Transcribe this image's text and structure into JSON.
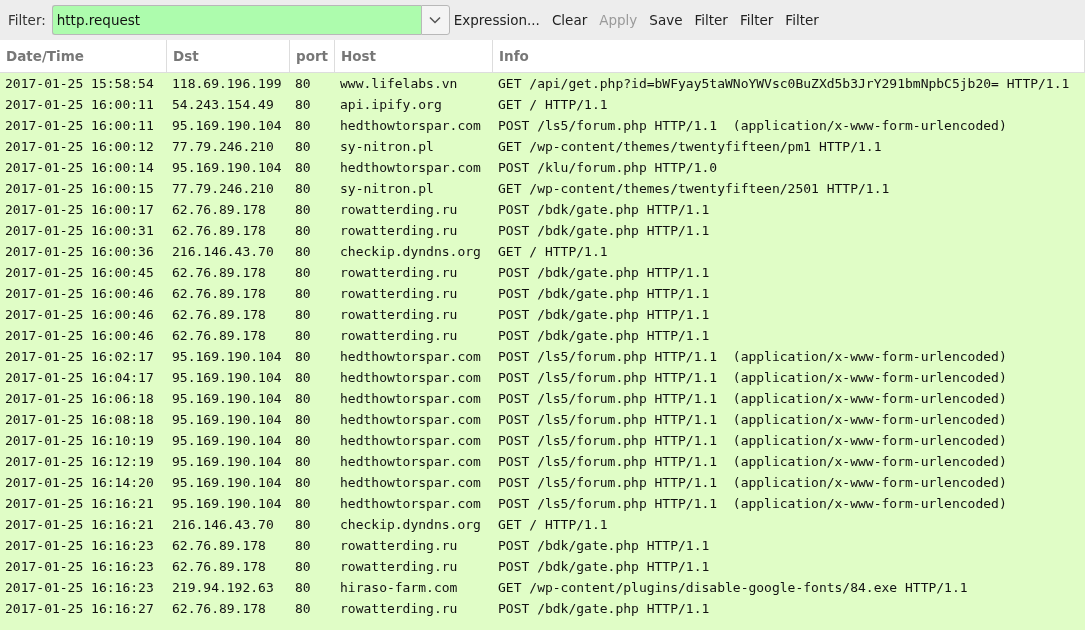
{
  "filter_bar": {
    "label": "Filter:",
    "value": "http.request",
    "buttons": [
      {
        "label": "Expression...",
        "disabled": false
      },
      {
        "label": "Clear",
        "disabled": false
      },
      {
        "label": "Apply",
        "disabled": true
      },
      {
        "label": "Save",
        "disabled": false
      },
      {
        "label": "Filter",
        "disabled": false
      },
      {
        "label": "Filter",
        "disabled": false
      },
      {
        "label": "Filter",
        "disabled": false
      }
    ]
  },
  "table": {
    "columns": [
      "Date/Time",
      "Dst",
      "port",
      "Host",
      "Info"
    ],
    "rows": [
      [
        "2017-01-25 15:58:54",
        "118.69.196.199",
        "80",
        "www.lifelabs.vn",
        "GET /api/get.php?id=bWFyay5taWNoYWVsc0BuZXd5b3JrY291bmNpbC5jb20= HTTP/1.1"
      ],
      [
        "2017-01-25 16:00:11",
        "54.243.154.49",
        "80",
        "api.ipify.org",
        "GET / HTTP/1.1"
      ],
      [
        "2017-01-25 16:00:11",
        "95.169.190.104",
        "80",
        "hedthowtorspar.com",
        "POST /ls5/forum.php HTTP/1.1  (application/x-www-form-urlencoded)"
      ],
      [
        "2017-01-25 16:00:12",
        "77.79.246.210",
        "80",
        "sy-nitron.pl",
        "GET /wp-content/themes/twentyfifteen/pm1 HTTP/1.1"
      ],
      [
        "2017-01-25 16:00:14",
        "95.169.190.104",
        "80",
        "hedthowtorspar.com",
        "POST /klu/forum.php HTTP/1.0"
      ],
      [
        "2017-01-25 16:00:15",
        "77.79.246.210",
        "80",
        "sy-nitron.pl",
        "GET /wp-content/themes/twentyfifteen/2501 HTTP/1.1"
      ],
      [
        "2017-01-25 16:00:17",
        "62.76.89.178",
        "80",
        "rowatterding.ru",
        "POST /bdk/gate.php HTTP/1.1"
      ],
      [
        "2017-01-25 16:00:31",
        "62.76.89.178",
        "80",
        "rowatterding.ru",
        "POST /bdk/gate.php HTTP/1.1"
      ],
      [
        "2017-01-25 16:00:36",
        "216.146.43.70",
        "80",
        "checkip.dyndns.org",
        "GET / HTTP/1.1"
      ],
      [
        "2017-01-25 16:00:45",
        "62.76.89.178",
        "80",
        "rowatterding.ru",
        "POST /bdk/gate.php HTTP/1.1"
      ],
      [
        "2017-01-25 16:00:46",
        "62.76.89.178",
        "80",
        "rowatterding.ru",
        "POST /bdk/gate.php HTTP/1.1"
      ],
      [
        "2017-01-25 16:00:46",
        "62.76.89.178",
        "80",
        "rowatterding.ru",
        "POST /bdk/gate.php HTTP/1.1"
      ],
      [
        "2017-01-25 16:00:46",
        "62.76.89.178",
        "80",
        "rowatterding.ru",
        "POST /bdk/gate.php HTTP/1.1"
      ],
      [
        "2017-01-25 16:02:17",
        "95.169.190.104",
        "80",
        "hedthowtorspar.com",
        "POST /ls5/forum.php HTTP/1.1  (application/x-www-form-urlencoded)"
      ],
      [
        "2017-01-25 16:04:17",
        "95.169.190.104",
        "80",
        "hedthowtorspar.com",
        "POST /ls5/forum.php HTTP/1.1  (application/x-www-form-urlencoded)"
      ],
      [
        "2017-01-25 16:06:18",
        "95.169.190.104",
        "80",
        "hedthowtorspar.com",
        "POST /ls5/forum.php HTTP/1.1  (application/x-www-form-urlencoded)"
      ],
      [
        "2017-01-25 16:08:18",
        "95.169.190.104",
        "80",
        "hedthowtorspar.com",
        "POST /ls5/forum.php HTTP/1.1  (application/x-www-form-urlencoded)"
      ],
      [
        "2017-01-25 16:10:19",
        "95.169.190.104",
        "80",
        "hedthowtorspar.com",
        "POST /ls5/forum.php HTTP/1.1  (application/x-www-form-urlencoded)"
      ],
      [
        "2017-01-25 16:12:19",
        "95.169.190.104",
        "80",
        "hedthowtorspar.com",
        "POST /ls5/forum.php HTTP/1.1  (application/x-www-form-urlencoded)"
      ],
      [
        "2017-01-25 16:14:20",
        "95.169.190.104",
        "80",
        "hedthowtorspar.com",
        "POST /ls5/forum.php HTTP/1.1  (application/x-www-form-urlencoded)"
      ],
      [
        "2017-01-25 16:16:21",
        "95.169.190.104",
        "80",
        "hedthowtorspar.com",
        "POST /ls5/forum.php HTTP/1.1  (application/x-www-form-urlencoded)"
      ],
      [
        "2017-01-25 16:16:21",
        "216.146.43.70",
        "80",
        "checkip.dyndns.org",
        "GET / HTTP/1.1"
      ],
      [
        "2017-01-25 16:16:23",
        "62.76.89.178",
        "80",
        "rowatterding.ru",
        "POST /bdk/gate.php HTTP/1.1"
      ],
      [
        "2017-01-25 16:16:23",
        "62.76.89.178",
        "80",
        "rowatterding.ru",
        "POST /bdk/gate.php HTTP/1.1"
      ],
      [
        "2017-01-25 16:16:23",
        "219.94.192.63",
        "80",
        "hiraso-farm.com",
        "GET /wp-content/plugins/disable-google-fonts/84.exe HTTP/1.1"
      ],
      [
        "2017-01-25 16:16:27",
        "62.76.89.178",
        "80",
        "rowatterding.ru",
        "POST /bdk/gate.php HTTP/1.1"
      ]
    ]
  }
}
